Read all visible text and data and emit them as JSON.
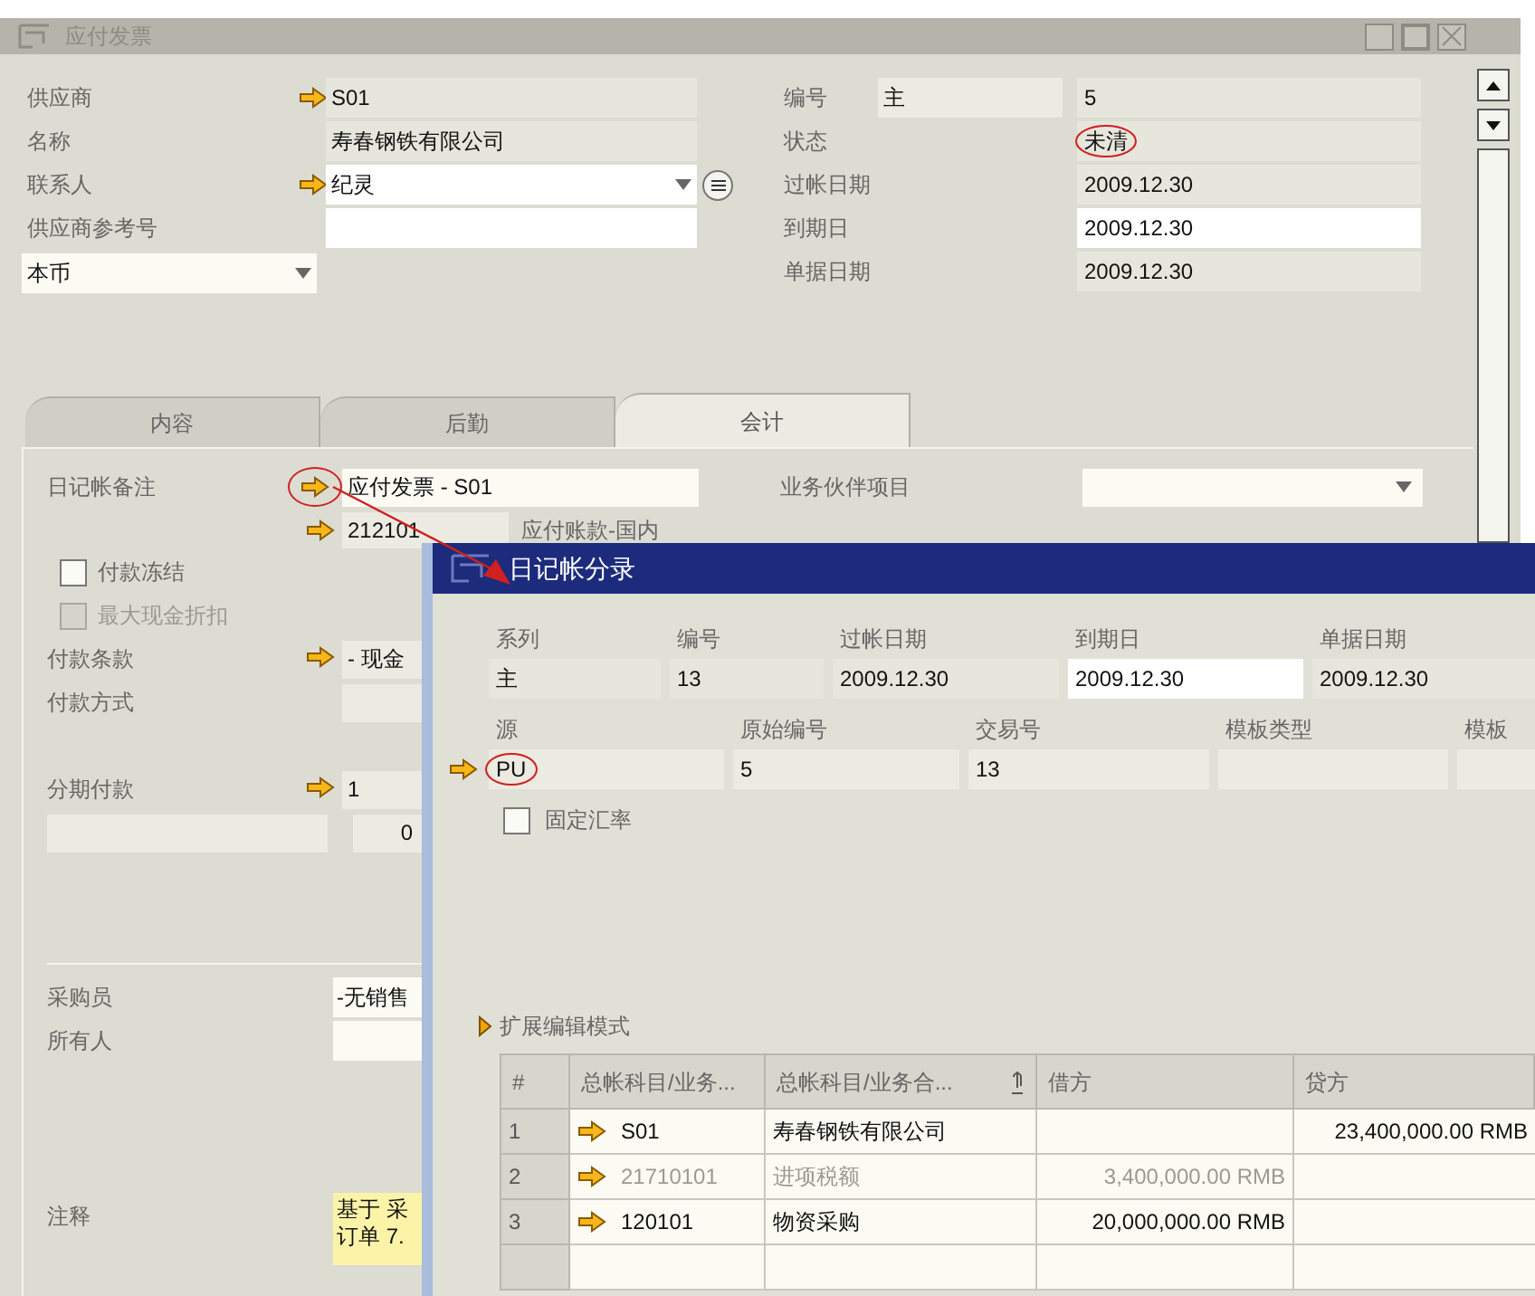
{
  "window": {
    "title": "应付发票"
  },
  "vendor_fields": [
    {
      "kind": "text",
      "label": "供应商",
      "value": "S01",
      "link": true,
      "editable": false
    },
    {
      "kind": "text",
      "label": "名称",
      "value": "寿春钢铁有限公司",
      "link": false,
      "editable": false
    },
    {
      "kind": "contact",
      "label": "联系人",
      "value": "纪灵",
      "link": true,
      "editable": true
    },
    {
      "kind": "text",
      "label": "供应商参考号",
      "link": false,
      "editable": true
    }
  ],
  "currency": {
    "value": "本币"
  },
  "document_fields": [
    {
      "label": "编号",
      "series": "主",
      "value": "5",
      "editable": false,
      "circled": false
    },
    {
      "label": "状态",
      "value": "未清",
      "editable": false,
      "circled": true
    },
    {
      "label": "过帐日期",
      "value": "2009.12.30",
      "editable": false,
      "circled": false
    },
    {
      "label": "到期日",
      "value": "2009.12.30",
      "editable": true,
      "circled": false
    },
    {
      "label": "单据日期",
      "value": "2009.12.30",
      "editable": false,
      "circled": false
    }
  ],
  "tabs": [
    {
      "label": "内容",
      "selected": false
    },
    {
      "label": "后勤",
      "selected": false
    },
    {
      "label": "会计",
      "selected": true
    }
  ],
  "accounting": {
    "journal_remark": {
      "label": "日记帐备注",
      "value": "应付发票 - S01",
      "circled": true
    },
    "bp_project": {
      "label": "业务伙伴项目"
    },
    "control_account": {
      "code": "212101",
      "name": "应付账款-国内"
    },
    "payment": [
      {
        "kind": "checkbox",
        "label": "付款冻结",
        "checked": false,
        "disabled": false
      },
      {
        "kind": "checkbox",
        "label": "最大现金折扣",
        "checked": false,
        "disabled": true
      },
      {
        "kind": "field",
        "label": "付款条款",
        "value": "- 现金",
        "link": true
      },
      {
        "kind": "field",
        "label": "付款方式",
        "link": false
      }
    ],
    "installments": [
      {
        "kind": "field",
        "label": "分期付款",
        "value": "1",
        "link": true
      },
      {
        "kind": "split",
        "value": "0"
      }
    ],
    "purchasing": [
      {
        "label": "采购员",
        "value": "-无销售"
      },
      {
        "label": "所有人"
      }
    ],
    "remarks": {
      "label": "注释",
      "lines": [
        "基于 采",
        "订单 7."
      ]
    }
  },
  "journal_dialog": {
    "title": "日记帐分录",
    "row_1": [
      {
        "label": "系列",
        "value": "主",
        "editable": false
      },
      {
        "label": "编号",
        "value": "13",
        "editable": false
      },
      {
        "label": "过帐日期",
        "value": "2009.12.30",
        "editable": false
      },
      {
        "label": "到期日",
        "value": "2009.12.30",
        "editable": true
      },
      {
        "label": "单据日期",
        "value": "2009.12.30",
        "editable": false
      }
    ],
    "row_2": [
      {
        "label": "源",
        "value": "PU",
        "link": true,
        "circled": true
      },
      {
        "label": "原始编号",
        "value": "5"
      },
      {
        "label": "交易号",
        "value": "13"
      },
      {
        "label": "模板类型"
      },
      {
        "label": "模板"
      }
    ],
    "fixed_rate": {
      "label": "固定汇率",
      "checked": false
    },
    "expand": {
      "label": "扩展编辑模式"
    },
    "table": {
      "columns": [
        "#",
        "总帐科目/业务...",
        "总帐科目/业务合...",
        "借方",
        "贷方"
      ],
      "rows": [
        {
          "number": "1",
          "account": "S01",
          "name": "寿春钢铁有限公司",
          "credit": "23,400,000.00 RMB",
          "disabled": false
        },
        {
          "number": "2",
          "account": "21710101",
          "name": "进项税额",
          "debit": "3,400,000.00 RMB",
          "disabled": true
        },
        {
          "number": "3",
          "account": "120101",
          "name": "物资采购",
          "debit": "20,000,000.00 RMB",
          "disabled": false
        }
      ]
    }
  }
}
